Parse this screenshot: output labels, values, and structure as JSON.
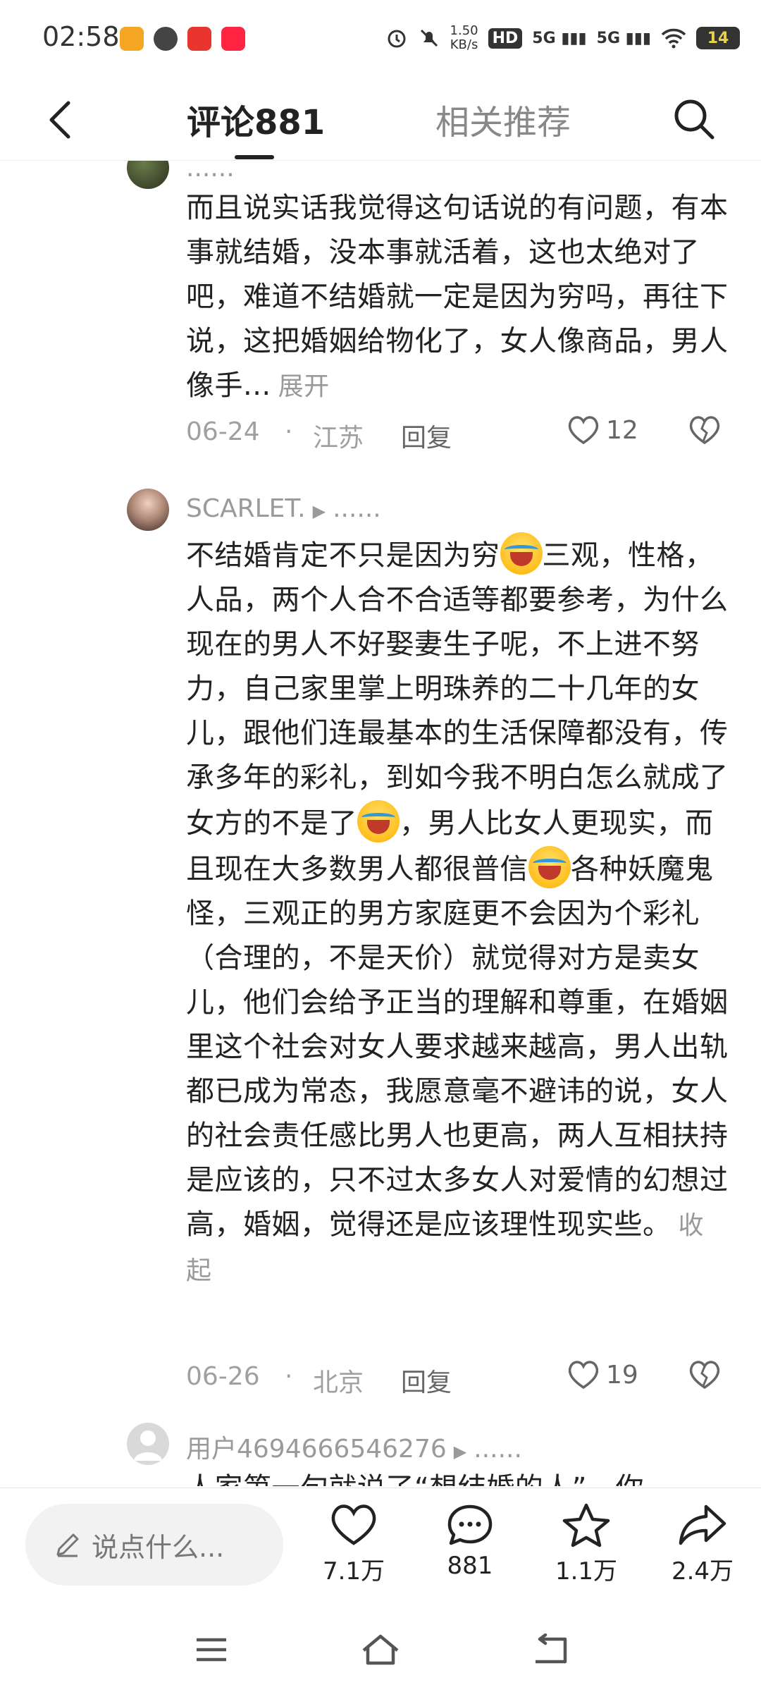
{
  "status_bar": {
    "time": "02:58",
    "net_speed_value": "1.50",
    "net_speed_unit": "KB/s",
    "hd": "HD",
    "sim1": "5G",
    "sim2": "5G",
    "battery": "14"
  },
  "header": {
    "tab_comments": "评论881",
    "tab_related": "相关推荐"
  },
  "comments": [
    {
      "username": "......",
      "body": "而且说实话我觉得这句话说的有问题，有本事就结婚，没本事就活着，这也太绝对了吧，难道不结婚就一定是因为穷吗，再往下说，这把婚姻给物化了，女人像商品，男人像手...",
      "toggle": "展开",
      "date": "06-24",
      "separator": "·",
      "location": "江苏",
      "reply": "回复",
      "likes": "12"
    },
    {
      "username": "SCARLET.",
      "username_suffix": "......",
      "body_part1": "不结婚肯定不只是因为穷",
      "body_part2": "三观，性格，人品，两个人合不合适等都要参考，为什么现在的男人不好娶妻生子呢，不上进不努力，自己家里掌上明珠养的二十几年的女儿，跟他们连最基本的生活保障都没有，传承多年的彩礼，到如今我不明白怎么就成了女方的不是了",
      "body_part3": "，男人比女人更现实，而且现在大多数男人都很普信",
      "body_part4": "各种妖魔鬼怪，三观正的男方家庭更不会因为个彩礼（合理的，不是天价）就觉得对方是卖女儿，他们会给予正当的理解和尊重，在婚姻里这个社会对女人要求越来越高，男人出轨都已成为常态，我愿意毫不避讳的说，女人的社会责任感比男人也更高，两人互相扶持是应该的，只不过太多女人对爱情的幻想过高，婚姻，觉得还是应该理性现实些。",
      "toggle": "收起",
      "date": "06-26",
      "separator": "·",
      "location": "北京",
      "reply": "回复",
      "likes": "19"
    },
    {
      "username": "用户4694666546276",
      "username_suffix": "......",
      "body": "人家第一句就说了“想结婚的人”，你"
    }
  ],
  "action_bar": {
    "input_placeholder": "说点什么...",
    "likes": "7.1万",
    "comments": "881",
    "favorites": "1.1万",
    "shares": "2.4万"
  }
}
